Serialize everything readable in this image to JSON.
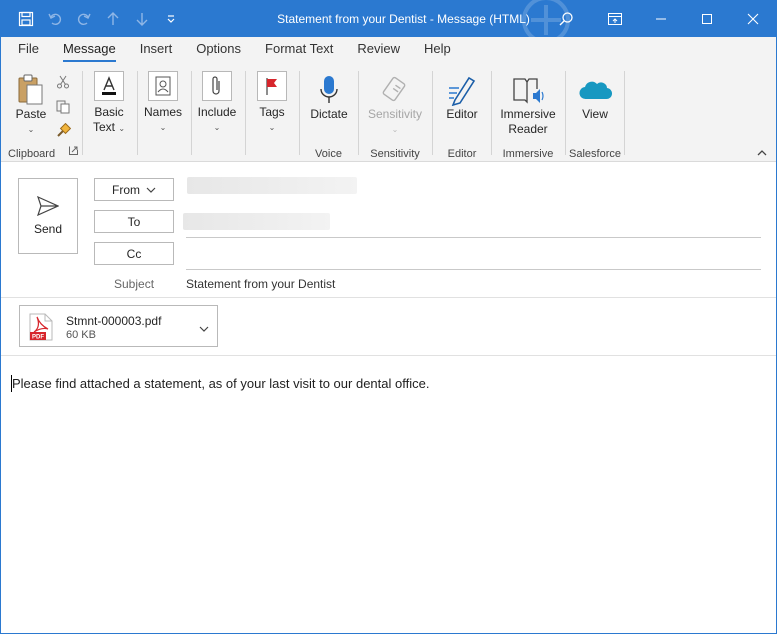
{
  "window": {
    "title": "Statement from your Dentist  -  Message (HTML)"
  },
  "ribbon_tabs": [
    "File",
    "Message",
    "Insert",
    "Options",
    "Format Text",
    "Review",
    "Help"
  ],
  "ribbon": {
    "clipboard": {
      "paste": "Paste",
      "group": "Clipboard"
    },
    "basic_text": {
      "line1": "Basic",
      "line2": "Text"
    },
    "names": "Names",
    "include": "Include",
    "tags": "Tags",
    "voice": {
      "dictate": "Dictate",
      "group": "Voice"
    },
    "sensitivity": {
      "button": "Sensitivity",
      "group": "Sensitivity"
    },
    "editor": {
      "button": "Editor",
      "group": "Editor"
    },
    "immersive": {
      "line1": "Immersive",
      "line2": "Reader",
      "group": "Immersive"
    },
    "salesforce": {
      "button": "View",
      "group": "Salesforce"
    }
  },
  "compose": {
    "send": "Send",
    "from": "From",
    "to": "To",
    "cc": "Cc",
    "subject_label": "Subject",
    "subject": "Statement from your Dentist"
  },
  "attachment": {
    "name": "Stmnt-000003.pdf",
    "size": "60 KB",
    "badge": "PDF"
  },
  "body": {
    "text": "Please find attached a statement, as of your last visit to our dental office."
  },
  "colors": {
    "titlebar": "#2b79d0",
    "ribbon": "#f3f3f3",
    "accent": "#2b79d0"
  }
}
